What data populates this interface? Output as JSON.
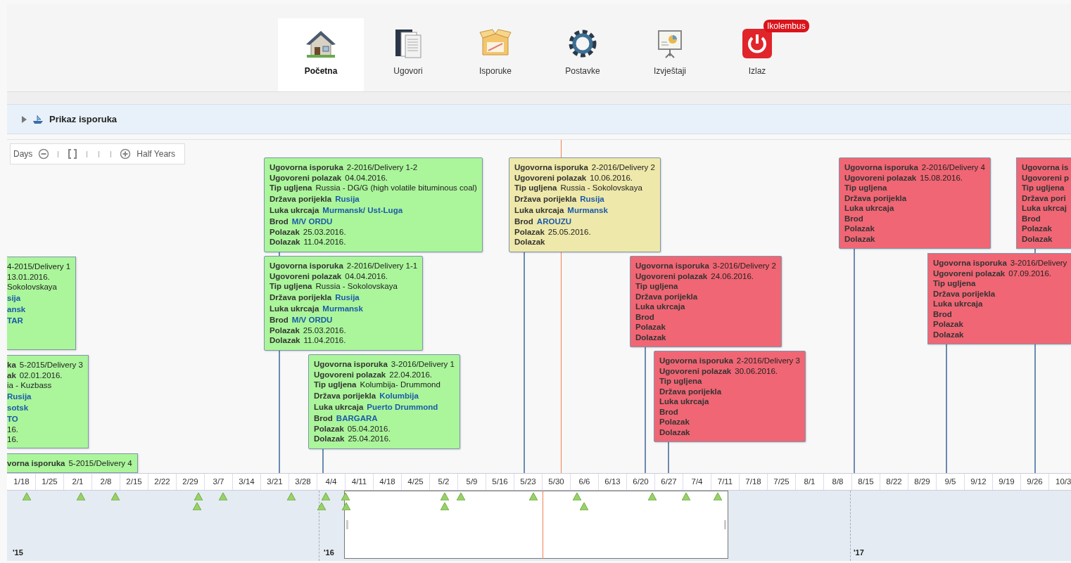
{
  "nav": {
    "items": [
      {
        "label": "Početna",
        "kind": "home",
        "selected": true
      },
      {
        "label": "Ugovori",
        "kind": "contracts",
        "selected": false
      },
      {
        "label": "Isporuke",
        "kind": "deliveries",
        "selected": false
      },
      {
        "label": "Postavke",
        "kind": "settings",
        "selected": false
      },
      {
        "label": "Izvještaji",
        "kind": "reports",
        "selected": false
      },
      {
        "label": "Izlaz",
        "kind": "exit",
        "selected": false,
        "badge": "Ikolembus"
      }
    ]
  },
  "panel": {
    "title": "Prikaz isporuka",
    "expanded": false
  },
  "zoom_control": {
    "min_label": "Days",
    "max_label": "Half Years"
  },
  "items": [
    {
      "kind": "clipped_left",
      "color": "#abf59b",
      "rows": [
        {
          "value": "4-2015/Delivery 1",
          "link": false
        },
        {
          "value": "13.01.2016.",
          "link": false
        },
        {
          "value": "Sokolovskaya",
          "link": false
        },
        {
          "value": "sija",
          "link": true
        },
        {
          "value": "ansk",
          "link": true
        },
        {
          "value": "TAR",
          "link": true
        }
      ]
    },
    {
      "kind": "clipped_left",
      "color": "#abf59b",
      "rows": [
        {
          "label": "ka",
          "value": "5-2015/Delivery 3",
          "link": false
        },
        {
          "label": "ak",
          "value": "02.01.2016.",
          "link": false
        },
        {
          "value": "ia - Kuzbass",
          "link": false
        },
        {
          "value": "Rusija",
          "link": true
        },
        {
          "value": "sotsk",
          "link": true
        },
        {
          "value": "TO",
          "link": true
        },
        {
          "value": "16.",
          "link": false
        },
        {
          "value": "16.",
          "link": false
        }
      ]
    },
    {
      "kind": "clipped_left",
      "color": "#abf59b",
      "rows": [
        {
          "label": "vorna isporuka",
          "value": "5-2015/Delivery 4",
          "link": false
        }
      ]
    },
    {
      "kind": "full",
      "color": "#abf59b",
      "rows": [
        {
          "label": "Ugovorna isporuka",
          "value": "2-2016/Delivery 1-2",
          "link": false
        },
        {
          "label": "Ugovoreni polazak",
          "value": "04.04.2016.",
          "link": false
        },
        {
          "label": "Tip ugljena",
          "value": "Russia - DG/G (high volatile bituminous coal)",
          "link": false
        },
        {
          "label": "Država porijekla",
          "value": "Rusija",
          "link": true
        },
        {
          "label": "Luka ukrcaja",
          "value": "Murmansk/ Ust-Luga",
          "link": true
        },
        {
          "label": "Brod",
          "value": "M/V ORDU",
          "link": true
        },
        {
          "label": "Polazak",
          "value": "25.03.2016.",
          "link": false
        },
        {
          "label": "Dolazak",
          "value": "11.04.2016.",
          "link": false
        }
      ]
    },
    {
      "kind": "full",
      "color": "#abf59b",
      "rows": [
        {
          "label": "Ugovorna isporuka",
          "value": "2-2016/Delivery 1-1",
          "link": false
        },
        {
          "label": "Ugovoreni polazak",
          "value": "04.04.2016.",
          "link": false
        },
        {
          "label": "Tip ugljena",
          "value": "Russia - Sokolovskaya",
          "link": false
        },
        {
          "label": "Država porijekla",
          "value": "Rusija",
          "link": true
        },
        {
          "label": "Luka ukrcaja",
          "value": "Murmansk",
          "link": true
        },
        {
          "label": "Brod",
          "value": "M/V ORDU",
          "link": true
        },
        {
          "label": "Polazak",
          "value": "25.03.2016.",
          "link": false
        },
        {
          "label": "Dolazak",
          "value": "11.04.2016.",
          "link": false
        }
      ]
    },
    {
      "kind": "full",
      "color": "#abf59b",
      "rows": [
        {
          "label": "Ugovorna isporuka",
          "value": "3-2016/Delivery 1",
          "link": false
        },
        {
          "label": "Ugovoreni polazak",
          "value": "22.04.2016.",
          "link": false
        },
        {
          "label": "Tip ugljena",
          "value": "Kolumbija- Drummond",
          "link": false
        },
        {
          "label": "Država porijekla",
          "value": "Kolumbija",
          "link": true
        },
        {
          "label": "Luka ukrcaja",
          "value": "Puerto Drummond",
          "link": true
        },
        {
          "label": "Brod",
          "value": "BARGARA",
          "link": true
        },
        {
          "label": "Polazak",
          "value": "05.04.2016.",
          "link": false
        },
        {
          "label": "Dolazak",
          "value": "25.04.2016.",
          "link": false
        }
      ]
    },
    {
      "kind": "full",
      "color": "#eee8aa",
      "rows": [
        {
          "label": "Ugovorna isporuka",
          "value": "2-2016/Delivery 2",
          "link": false
        },
        {
          "label": "Ugovoreni polazak",
          "value": "10.06.2016.",
          "link": false
        },
        {
          "label": "Tip ugljena",
          "value": "Russia - Sokolovskaya",
          "link": false
        },
        {
          "label": "Država porijekla",
          "value": "Rusija",
          "link": true
        },
        {
          "label": "Luka ukrcaja",
          "value": "Murmansk",
          "link": true
        },
        {
          "label": "Brod",
          "value": "AROUZU",
          "link": true
        },
        {
          "label": "Polazak",
          "value": "25.05.2016.",
          "link": false
        },
        {
          "label": "Dolazak"
        }
      ]
    },
    {
      "kind": "full",
      "color": "#f06674",
      "rows": [
        {
          "label": "Ugovorna isporuka",
          "value": "3-2016/Delivery 2",
          "link": false
        },
        {
          "label": "Ugovoreni polazak",
          "value": "24.06.2016.",
          "link": false
        },
        {
          "label": "Tip ugljena"
        },
        {
          "label": "Država porijekla"
        },
        {
          "label": "Luka ukrcaja"
        },
        {
          "label": "Brod"
        },
        {
          "label": "Polazak"
        },
        {
          "label": "Dolazak"
        }
      ]
    },
    {
      "kind": "full",
      "color": "#f06674",
      "rows": [
        {
          "label": "Ugovorna isporuka",
          "value": "2-2016/Delivery 3",
          "link": false
        },
        {
          "label": "Ugovoreni polazak",
          "value": "30.06.2016.",
          "link": false
        },
        {
          "label": "Tip ugljena"
        },
        {
          "label": "Država porijekla"
        },
        {
          "label": "Luka ukrcaja"
        },
        {
          "label": "Brod"
        },
        {
          "label": "Polazak"
        },
        {
          "label": "Dolazak"
        }
      ]
    },
    {
      "kind": "full",
      "color": "#f06674",
      "rows": [
        {
          "label": "Ugovorna isporuka",
          "value": "2-2016/Delivery 4",
          "link": false
        },
        {
          "label": "Ugovoreni polazak",
          "value": "15.08.2016.",
          "link": false
        },
        {
          "label": "Tip ugljena"
        },
        {
          "label": "Država porijekla"
        },
        {
          "label": "Luka ukrcaja"
        },
        {
          "label": "Brod"
        },
        {
          "label": "Polazak"
        },
        {
          "label": "Dolazak"
        }
      ]
    },
    {
      "kind": "clipped_right",
      "color": "#f06674",
      "rows": [
        {
          "label": "Ugovorna is"
        },
        {
          "label": "Ugovoreni p"
        },
        {
          "label": "Tip ugljena"
        },
        {
          "label": "Država pori"
        },
        {
          "label": "Luka ukrcaj"
        },
        {
          "label": "Brod"
        },
        {
          "label": "Polazak"
        },
        {
          "label": "Dolazak"
        }
      ]
    },
    {
      "kind": "clipped_right",
      "color": "#f06674",
      "rows": [
        {
          "label": "Ugovorna isporuka",
          "value": "3-2016/Delivery",
          "link": false
        },
        {
          "label": "Ugovoreni polazak",
          "value": "07.09.2016.",
          "link": false
        },
        {
          "label": "Tip ugljena"
        },
        {
          "label": "Država porijekla"
        },
        {
          "label": "Luka ukrcaja"
        },
        {
          "label": "Brod"
        },
        {
          "label": "Polazak"
        },
        {
          "label": "Dolazak"
        }
      ]
    }
  ],
  "axis": {
    "ticks": [
      "1/18",
      "1/25",
      "2/1",
      "2/8",
      "2/15",
      "2/22",
      "2/29",
      "3/7",
      "3/14",
      "3/21",
      "3/28",
      "4/4",
      "4/11",
      "4/18",
      "4/25",
      "5/2",
      "5/9",
      "5/16",
      "5/23",
      "5/30",
      "6/6",
      "6/13",
      "6/20",
      "6/27",
      "7/4",
      "7/11",
      "7/18",
      "7/25",
      "8/1",
      "8/8",
      "8/15",
      "8/22",
      "8/29",
      "9/5",
      "9/12",
      "9/19",
      "9/26",
      "10/3"
    ]
  },
  "navigator": {
    "years": [
      "'15",
      "'16",
      "'17"
    ]
  }
}
